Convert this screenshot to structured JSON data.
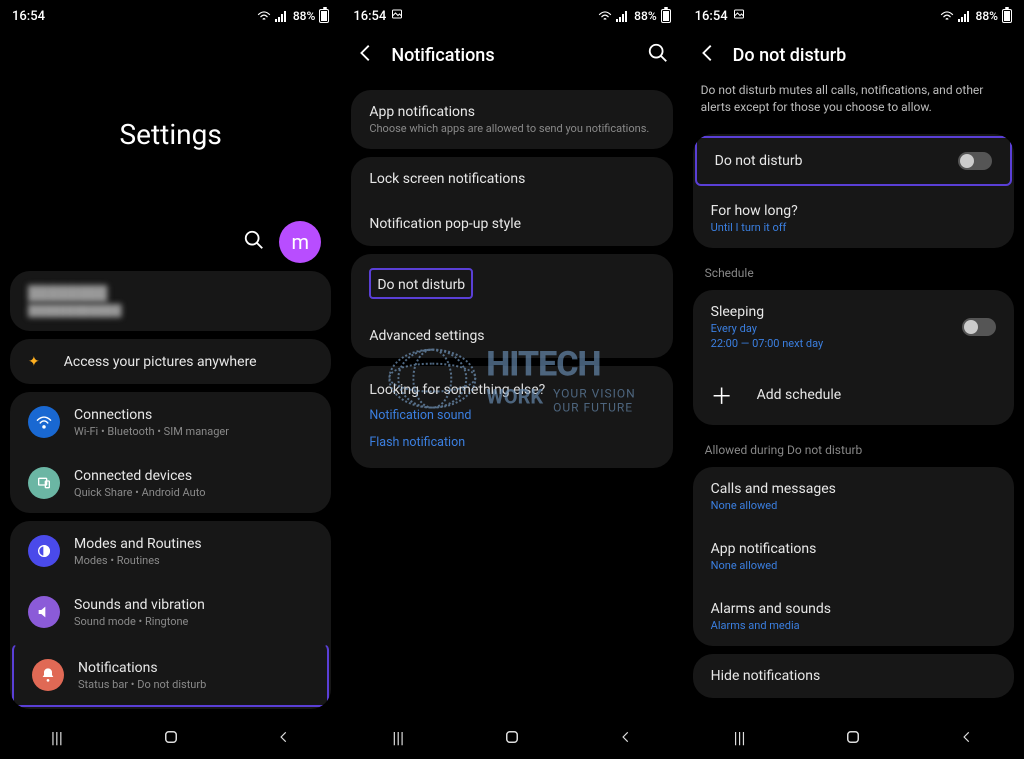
{
  "status": {
    "time": "16:54",
    "battery": "88%",
    "nb_icon": "picture-icon"
  },
  "panel1": {
    "title": "Settings",
    "avatar_letter": "m",
    "blurred_title": "████████",
    "blurred_sub": "████████████",
    "banner": "Access your pictures anywhere",
    "items": {
      "connections": {
        "title": "Connections",
        "sub": "Wi-Fi  •  Bluetooth  •  SIM manager"
      },
      "connected": {
        "title": "Connected devices",
        "sub": "Quick Share  •  Android Auto"
      },
      "modes": {
        "title": "Modes and Routines",
        "sub": "Modes  •  Routines"
      },
      "sounds": {
        "title": "Sounds and vibration",
        "sub": "Sound mode  •  Ringtone"
      },
      "notifications": {
        "title": "Notifications",
        "sub": "Status bar  •  Do not disturb"
      }
    }
  },
  "panel2": {
    "title": "Notifications",
    "app_notif": {
      "title": "App notifications",
      "sub": "Choose which apps are allowed to send you notifications."
    },
    "lock_screen": "Lock screen notifications",
    "popup": "Notification pop-up style",
    "dnd": "Do not disturb",
    "advanced": "Advanced settings",
    "looking": {
      "title": "Looking for something else?",
      "links": [
        "Notification sound",
        "Flash notification"
      ]
    }
  },
  "panel3": {
    "title": "Do not disturb",
    "desc": "Do not disturb mutes all calls, notifications, and other alerts except for those you choose to allow.",
    "dnd_toggle": "Do not disturb",
    "how_long": {
      "title": "For how long?",
      "sub": "Until I turn it off"
    },
    "schedule_header": "Schedule",
    "sleeping": {
      "title": "Sleeping",
      "sub1": "Every day",
      "sub2": "22:00 — 07:00 next day"
    },
    "add_schedule": "Add schedule",
    "allowed_header": "Allowed during Do not disturb",
    "calls": {
      "title": "Calls and messages",
      "sub": "None allowed"
    },
    "app_notif": {
      "title": "App notifications",
      "sub": "None allowed"
    },
    "alarms": {
      "title": "Alarms and sounds",
      "sub": "Alarms and media"
    },
    "hide": "Hide notifications"
  },
  "watermark": {
    "brand": "HITECH",
    "sub": "WORK",
    "tag1": "YOUR VISION",
    "tag2": "OUR FUTURE"
  }
}
